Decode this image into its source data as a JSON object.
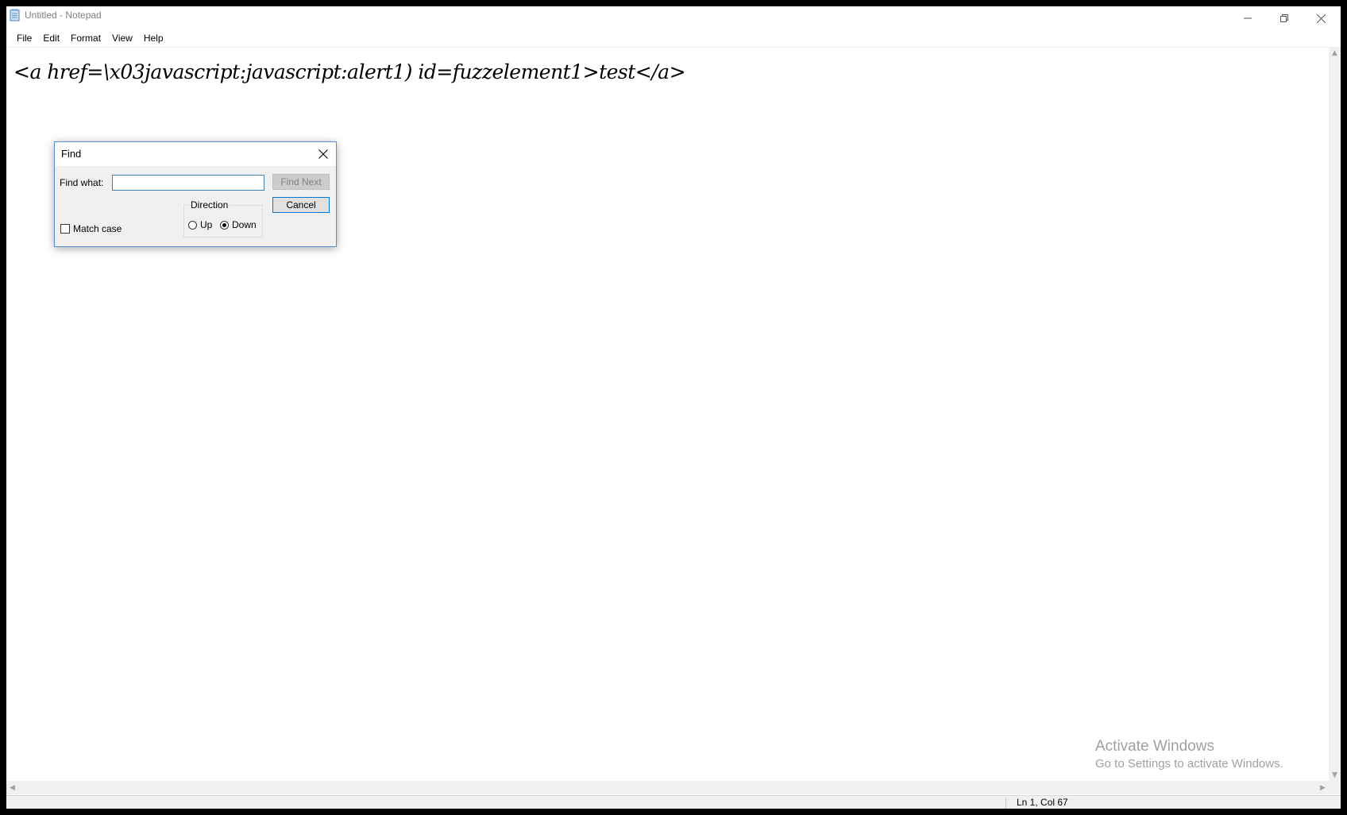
{
  "window": {
    "title": "Untitled - Notepad",
    "controls": {
      "minimize_icon": "minimize-icon",
      "restore_icon": "restore-icon",
      "close_icon": "close-icon"
    }
  },
  "menu": [
    "File",
    "Edit",
    "Format",
    "View",
    "Help"
  ],
  "editor": {
    "content": "<a href=\\x03javascript:javascript:alert1) id=fuzzelement1>test</a>"
  },
  "status": {
    "position": "Ln 1, Col 67"
  },
  "watermark": {
    "title": "Activate Windows",
    "subtitle": "Go to Settings to activate Windows."
  },
  "find_dialog": {
    "title": "Find",
    "find_what_label": "Find what:",
    "find_what_value": "",
    "find_next_label": "Find Next",
    "cancel_label": "Cancel",
    "direction_label": "Direction",
    "up_label": "Up",
    "down_label": "Down",
    "direction_selected": "Down",
    "match_case_label": "Match case",
    "match_case_checked": false
  },
  "colors": {
    "focus_border": "#0078d7",
    "dialog_border": "#5b8dd6"
  }
}
